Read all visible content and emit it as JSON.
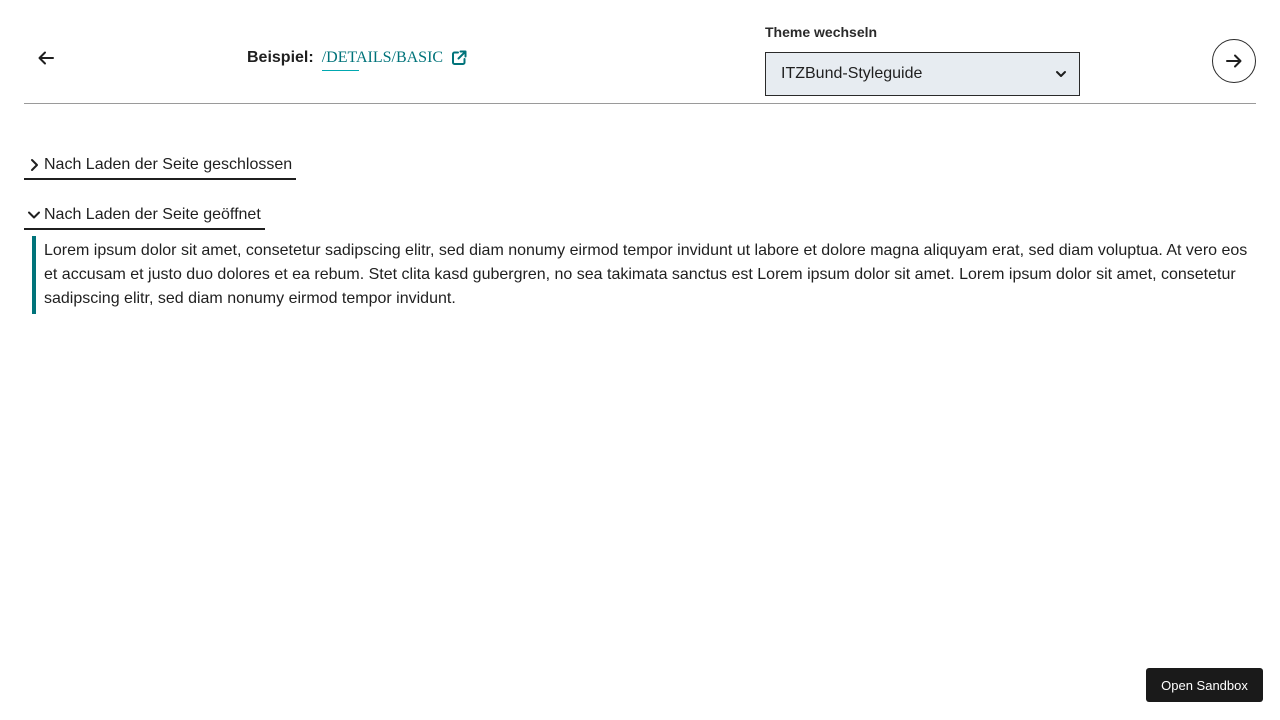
{
  "header": {
    "back_icon": "arrow-left-icon",
    "example_label": "Beispiel:",
    "example_link": "/DETAILS/BASIC",
    "external_icon": "external-link-icon",
    "theme": {
      "label": "Theme wechseln",
      "selected": "ITZBund-Styleguide"
    },
    "next_icon": "arrow-right-icon"
  },
  "details": [
    {
      "summary": "Nach Laden der Seite geschlossen",
      "open": false
    },
    {
      "summary": "Nach Laden der Seite geöffnet",
      "open": true,
      "content": "Lorem ipsum dolor sit amet, consetetur sadipscing elitr, sed diam nonumy eirmod tempor invidunt ut labore et dolore magna aliquyam erat, sed diam voluptua. At vero eos et accusam et justo duo dolores et ea rebum. Stet clita kasd gubergren, no sea takimata sanctus est Lorem ipsum dolor sit amet. Lorem ipsum dolor sit amet, con­setetur sadipscing elitr, sed diam nonumy eirmod tempor invidunt."
    }
  ],
  "sandbox_button": "Open Sandbox",
  "colors": {
    "accent": "#00737a",
    "select_bg": "#e7ecf1",
    "sandbox_bg": "#1a1a1a"
  }
}
